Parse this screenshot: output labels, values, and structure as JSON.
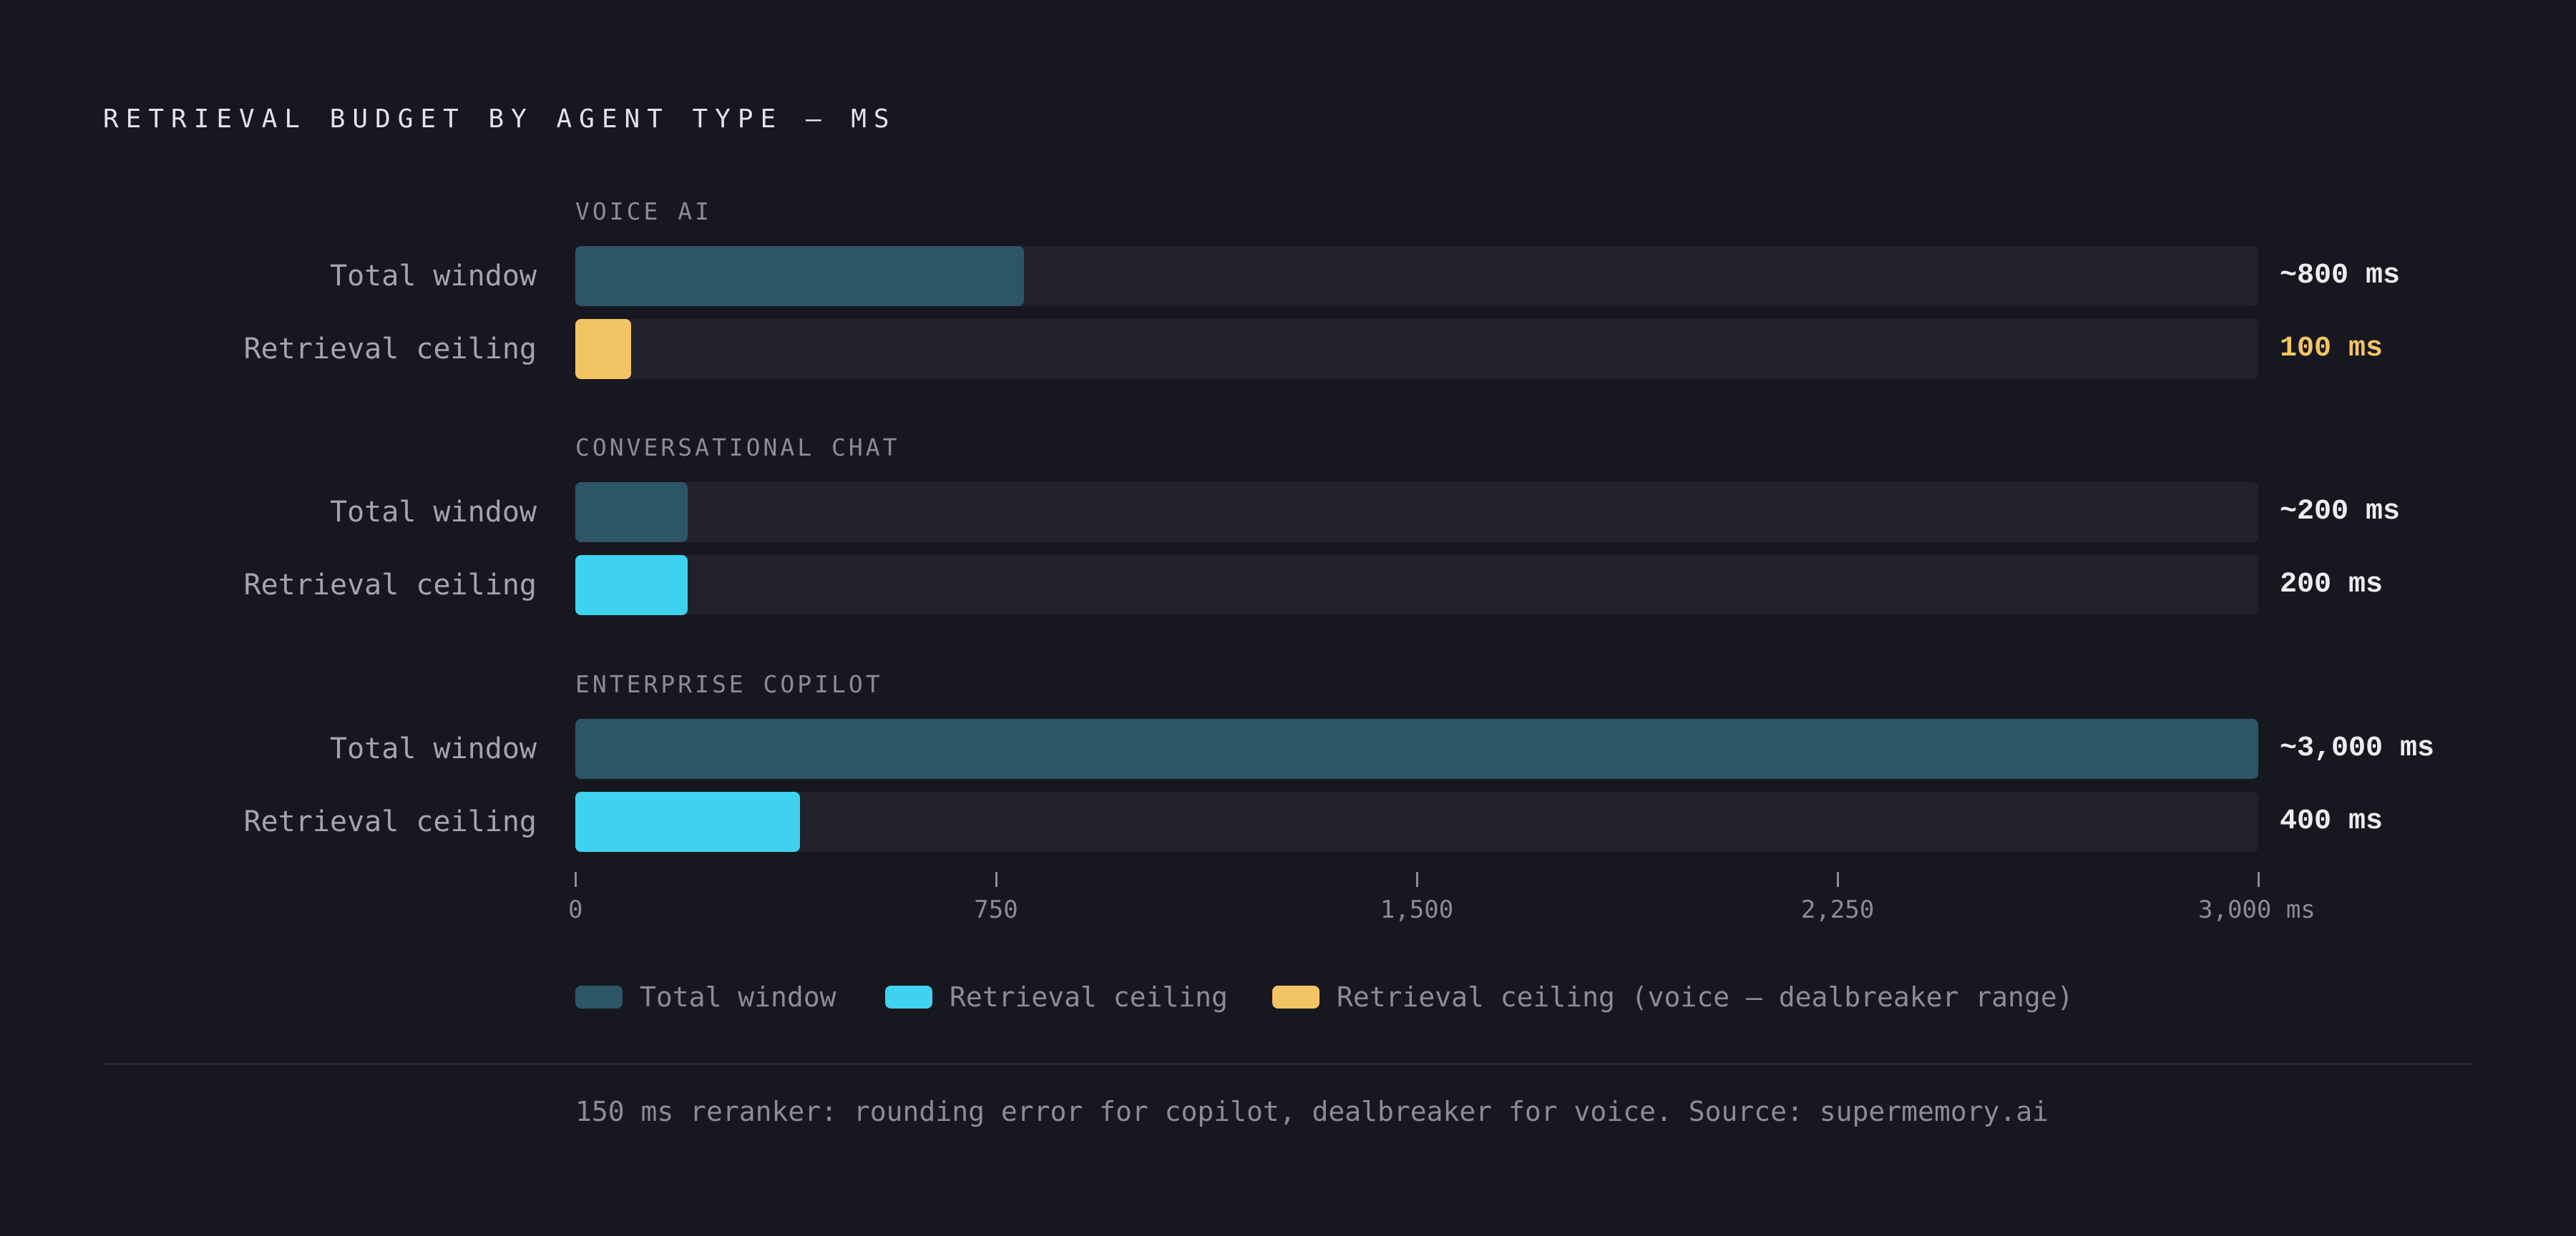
{
  "title": "RETRIEVAL BUDGET BY AGENT TYPE — MS",
  "colors": {
    "background": "#17171f",
    "track": "#22222c",
    "total_window": "#2c5566",
    "retrieval_ceiling": "#3fd2ef",
    "retrieval_ceiling_voice": "#f2c464",
    "value_text": "#ececf2",
    "value_text_voice": "#f2c464"
  },
  "chart_data": {
    "type": "bar",
    "orientation": "horizontal",
    "xlim": [
      0,
      3000
    ],
    "x_ticks": [
      "0",
      "750",
      "1,500",
      "2,250",
      "3,000 ms"
    ],
    "x_tick_values": [
      0,
      750,
      1500,
      2250,
      3000
    ],
    "groups": [
      {
        "name": "VOICE AI",
        "rows": [
          {
            "label": "Total window",
            "value": 800,
            "display": "~800 ms",
            "series": "total_window"
          },
          {
            "label": "Retrieval ceiling",
            "value": 100,
            "display": "100 ms",
            "series": "retrieval_ceiling_voice"
          }
        ]
      },
      {
        "name": "CONVERSATIONAL CHAT",
        "rows": [
          {
            "label": "Total window",
            "value": 200,
            "display": "~200 ms",
            "series": "total_window"
          },
          {
            "label": "Retrieval ceiling",
            "value": 200,
            "display": "200 ms",
            "series": "retrieval_ceiling"
          }
        ]
      },
      {
        "name": "ENTERPRISE COPILOT",
        "rows": [
          {
            "label": "Total window",
            "value": 3000,
            "display": "~3,000 ms",
            "series": "total_window"
          },
          {
            "label": "Retrieval ceiling",
            "value": 400,
            "display": "400 ms",
            "series": "retrieval_ceiling"
          }
        ]
      }
    ],
    "legend": [
      {
        "label": "Total window",
        "series": "total_window"
      },
      {
        "label": "Retrieval ceiling",
        "series": "retrieval_ceiling"
      },
      {
        "label": "Retrieval ceiling (voice — dealbreaker range)",
        "series": "retrieval_ceiling_voice"
      }
    ],
    "legend_position": "bottom",
    "grid": false
  },
  "footnote": "150 ms reranker: rounding error for copilot, dealbreaker for voice. Source: supermemory.ai"
}
